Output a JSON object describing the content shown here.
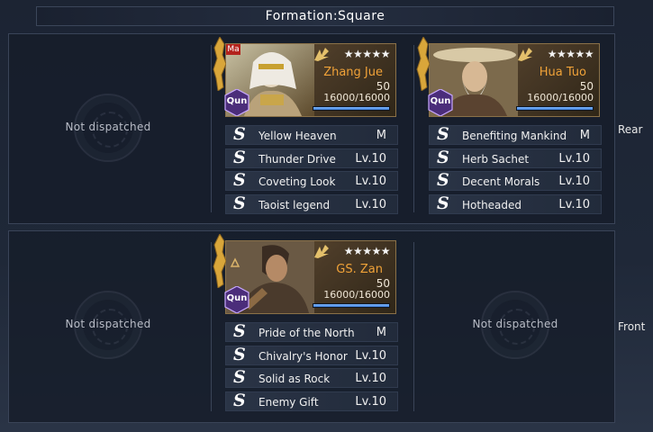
{
  "formation": {
    "title": "Formation:Square"
  },
  "rows": {
    "rear_label": "Rear",
    "front_label": "Front"
  },
  "empty_slot_text": "Not dispatched",
  "heroes": [
    {
      "name": "Zhang Jue",
      "level": "50",
      "hp": "16000/16000",
      "hp_fraction": 1.0,
      "faction": "Qun",
      "stars": "★★★★★",
      "tag": "Ma",
      "skills": [
        {
          "name": "Yellow Heaven",
          "level": "M"
        },
        {
          "name": "Thunder Drive",
          "level": "Lv.10"
        },
        {
          "name": "Coveting Look",
          "level": "Lv.10"
        },
        {
          "name": "Taoist legend",
          "level": "Lv.10"
        }
      ]
    },
    {
      "name": "Hua Tuo",
      "level": "50",
      "hp": "16000/16000",
      "hp_fraction": 1.0,
      "faction": "Qun",
      "stars": "★★★★★",
      "skills": [
        {
          "name": "Benefiting Mankind",
          "level": "M"
        },
        {
          "name": "Herb Sachet",
          "level": "Lv.10"
        },
        {
          "name": "Decent Morals",
          "level": "Lv.10"
        },
        {
          "name": "Hotheaded",
          "level": "Lv.10"
        }
      ]
    },
    {
      "name": "GS. Zan",
      "level": "50",
      "hp": "16000/16000",
      "hp_fraction": 1.0,
      "faction": "Qun",
      "stars": "★★★★★",
      "skills": [
        {
          "name": "Pride of the North",
          "level": "M"
        },
        {
          "name": "Chivalry's Honor",
          "level": "Lv.10"
        },
        {
          "name": "Solid as Rock",
          "level": "Lv.10"
        },
        {
          "name": "Enemy Gift",
          "level": "Lv.10"
        }
      ]
    }
  ],
  "skill_icon": "S",
  "colors": {
    "hero_name": "#f0a238",
    "faction_badge": "#4b2d7a",
    "hp_bar": "#4f8fe6"
  }
}
